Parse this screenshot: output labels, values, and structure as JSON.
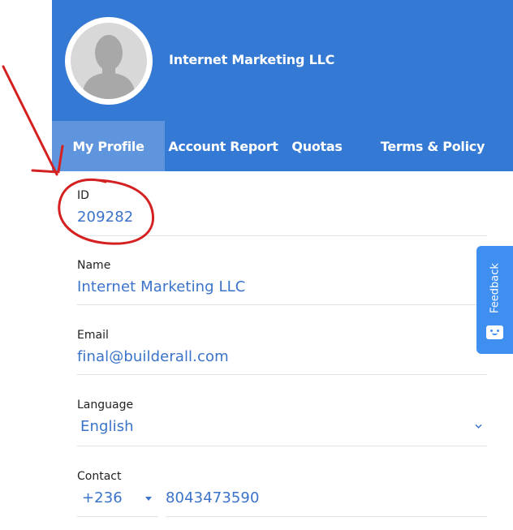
{
  "header": {
    "company_name": "Internet Marketing LLC",
    "background_color": "#3479d4",
    "avatar_icon": "user-silhouette-icon"
  },
  "tabs": [
    {
      "label": "My Profile",
      "active": true
    },
    {
      "label": "Account Report",
      "active": false
    },
    {
      "label": "Quotas",
      "active": false
    },
    {
      "label": "Terms & Policy",
      "active": false
    }
  ],
  "profile": {
    "id": {
      "label": "ID",
      "value": "209282"
    },
    "name": {
      "label": "Name",
      "value": "Internet Marketing LLC"
    },
    "email": {
      "label": "Email",
      "value": "final@builderall.com"
    },
    "language": {
      "label": "Language",
      "value": "English"
    },
    "contact": {
      "label": "Contact",
      "country_code": "+236",
      "phone": "8043473590"
    }
  },
  "feedback": {
    "label": "Feedback",
    "icon": "smiley-chat-icon",
    "color": "#3e8ff0"
  },
  "annotation": {
    "color": "#d42020",
    "shapes": [
      "arrow-pointer",
      "circle-highlight"
    ]
  },
  "accent_color": "#3a73c9"
}
